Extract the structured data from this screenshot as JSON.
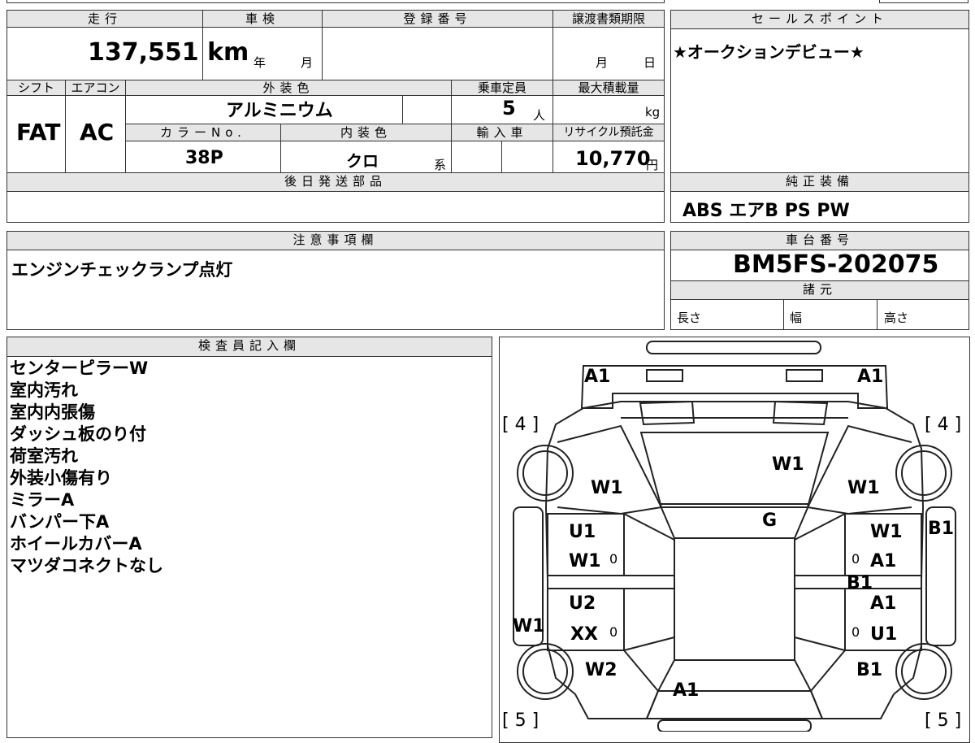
{
  "labels": {
    "mileage": "走行",
    "inspection": "車検",
    "registration": "登録番号",
    "transfer_deadline": "譲渡書類期限",
    "shift": "シフト",
    "aircon": "エアコン",
    "exterior_color": "外装色",
    "capacity": "乗車定員",
    "max_load": "最大積載量",
    "color_no": "カラーNo.",
    "interior_color": "内装色",
    "import": "輸入車",
    "recycle_fee": "リサイクル預託金",
    "later_parts": "後日発送部品",
    "sales_point": "セールスポイント",
    "genuine_equipment": "純正装備",
    "caution": "注意事項欄",
    "chassis_no": "車台番号",
    "specs": "諸元",
    "length": "長さ",
    "width": "幅",
    "height": "高さ",
    "inspector": "検査員記入欄"
  },
  "values": {
    "mileage": "137,551 km",
    "year_unit": "年",
    "month_unit": "月",
    "deadline_month": "月",
    "deadline_day": "日",
    "shift": "FAT",
    "aircon": "AC",
    "exterior_color": "アルミニウム",
    "capacity": "5",
    "capacity_unit": "人",
    "load_unit": "kg",
    "color_no": "38P",
    "interior_color": "クロ",
    "interior_suffix": "系",
    "recycle_fee": "10,770",
    "recycle_unit": "円",
    "sales_point": "★オークションデビュー★",
    "genuine_equipment": "ABS エアB PS PW",
    "caution": "エンジンチェックランプ点灯",
    "chassis_no": "BM5FS-202075"
  },
  "inspector_notes": [
    "センターピラーW",
    "室内汚れ",
    "室内内張傷",
    "ダッシュ板のり付",
    "荷室汚れ",
    "外装小傷有り",
    "ミラーA",
    "バンパー下A",
    "ホイールカバーA",
    "マツダコネクトなし"
  ],
  "diagram": {
    "marks": {
      "front_left": "A1",
      "front_right": "A1",
      "tire_fl": "[ 4 ]",
      "tire_fr": "[ 4 ]",
      "tire_rl": "[ 5 ]",
      "tire_rr": "[ 5 ]",
      "hood": "W1",
      "fender_left": "W1",
      "fender_right": "W1",
      "windshield": "G",
      "door_fl_1": "U1",
      "door_fl_2": "W1",
      "door_fr_1": "W1",
      "door_fr_2": "A1",
      "pillar_right": "B1",
      "door_rl_1": "U2",
      "door_rl_2": "XX",
      "door_rr_1": "A1",
      "door_rr_2": "U1",
      "side_left": "W1",
      "side_right": "B1",
      "quarter_left": "W2",
      "quarter_right": "B1",
      "rear": "A1",
      "zero_mark": "0"
    }
  }
}
